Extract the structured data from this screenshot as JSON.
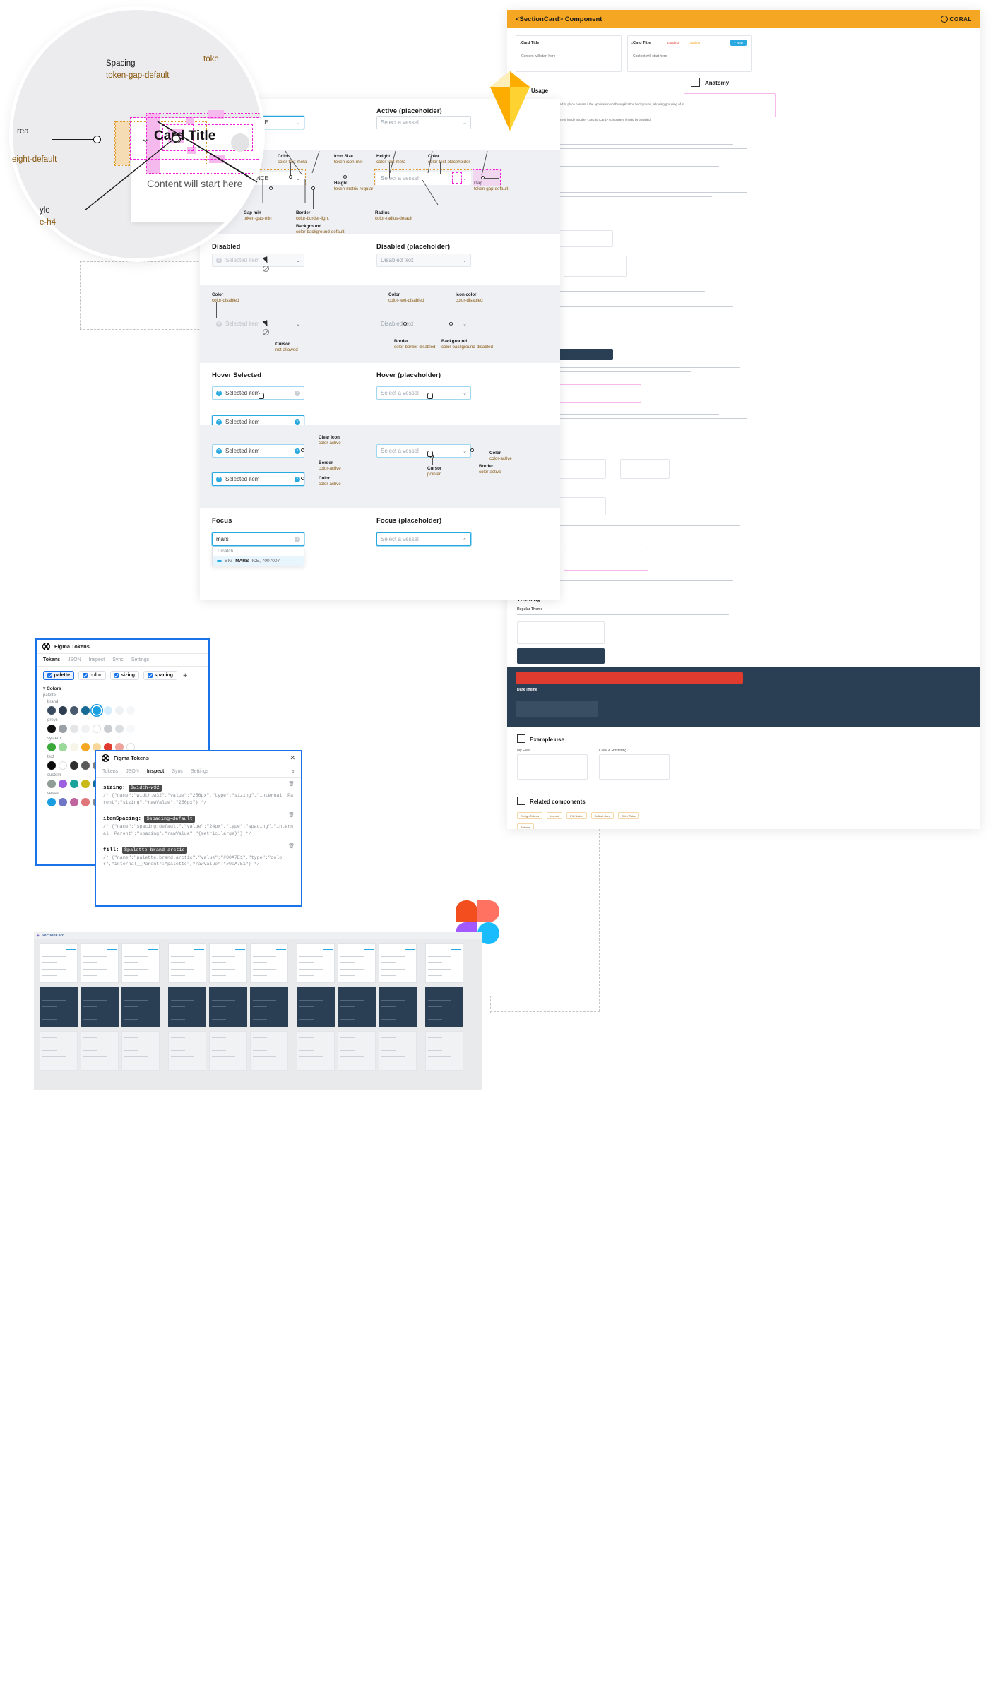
{
  "magnifier": {
    "annotations": [
      {
        "key": "Spacing",
        "value": "token-gap-default"
      },
      {
        "key": "rea",
        "value": "eight-default"
      },
      {
        "key": "yle",
        "value": "e-h4"
      },
      {
        "key": "toke",
        "value": ""
      }
    ],
    "card_title": "Card Title",
    "card_content": "Content will start here",
    "chevron_icon": "chevron-down-icon"
  },
  "spec": {
    "sections": [
      {
        "id": "active",
        "left_title": "",
        "right_title": "Active (placeholder)",
        "left_value": "RMRS, FRANCE",
        "right_placeholder": "Select a vessel"
      },
      {
        "id": "active-anno",
        "left_title": "",
        "right_title": "",
        "left_value": "RMRS, FRANCE",
        "right_placeholder": "Select a vessel"
      },
      {
        "id": "disabled",
        "left_title": "Disabled",
        "right_title": "Disabled (placeholder)",
        "left_value": "Selected item",
        "right_placeholder": "Disabled text"
      },
      {
        "id": "disabled-anno",
        "left_title": "",
        "right_title": "",
        "left_value": "Selected item",
        "right_placeholder": "Disabled text"
      },
      {
        "id": "hover",
        "left_title": "Hover Selected",
        "right_title": "Hover (placeholder)",
        "left_value": "Selected item",
        "right_placeholder": "Select a vessel",
        "left_value2": "Selected item"
      },
      {
        "id": "hover-anno",
        "left_title": "",
        "right_title": "",
        "left_value": "Selected item",
        "right_placeholder": "Select a vessel",
        "left_value2": "Selected item"
      },
      {
        "id": "focus",
        "left_title": "Focus",
        "right_title": "Focus (placeholder)",
        "left_value": "mars",
        "right_placeholder": "Select a vessel"
      }
    ],
    "annotations": {
      "active": [
        {
          "key": "Color",
          "value": "color-text-meta"
        },
        {
          "key": "Icon Size",
          "value": "token-icon-min"
        },
        {
          "key": "Height",
          "value": "color-text-meta"
        },
        {
          "key": "Color",
          "value": "color-text-placeholder"
        },
        {
          "key": "Height",
          "value": "token-metric-regular"
        },
        {
          "key": "Gap",
          "value": "token-gap-default"
        },
        {
          "key": "Gap min",
          "value": "token-gap-min"
        },
        {
          "key": "Border",
          "value": "color-border-light"
        },
        {
          "key": "Background",
          "value": "color-background-default"
        },
        {
          "key": "Radius",
          "value": "color-radius-default"
        },
        {
          "key": "",
          "value": "efault"
        }
      ],
      "disabled": [
        {
          "key": "Color",
          "value": "color-disabled"
        },
        {
          "key": "Color",
          "value": "color-text-disabled"
        },
        {
          "key": "Icon color",
          "value": "color-disabled"
        },
        {
          "key": "Cursor",
          "value": "not-allowed"
        },
        {
          "key": "Border",
          "value": "color-border-disabled"
        },
        {
          "key": "Background",
          "value": "color-background-disabled"
        }
      ],
      "hover": [
        {
          "key": "Clear icon",
          "value": "color-active"
        },
        {
          "key": "Border",
          "value": "color-active"
        },
        {
          "key": "Color",
          "value": "color-active"
        },
        {
          "key": "Cursor",
          "value": "pointer"
        },
        {
          "key": "Border",
          "value": "color-active"
        },
        {
          "key": "Color",
          "value": "color-active"
        }
      ]
    },
    "focus_dropdown": {
      "match_count": "1 match",
      "item_prefix": "BIG ",
      "item_bold": "MARS",
      "item_rest": "ICE, 7007007",
      "vessel_icon": "vessel-icon"
    }
  },
  "doc": {
    "title": "<SectionCard> Component",
    "brand": "CORAL",
    "cards": [
      {
        "title": "Card Title",
        "body": "Content will start here"
      },
      {
        "title": "Card Title",
        "body": "Content will start here",
        "tags": [
          "Loading",
          "Loading"
        ],
        "button": "+ New"
      }
    ],
    "sections": [
      {
        "icon": "target-icon",
        "title": "Usage"
      },
      {
        "icon": "anatomy-icon",
        "title": "Anatomy"
      },
      {
        "icon": "play-icon",
        "title": "Example use"
      },
      {
        "icon": "grid-icon",
        "title": "Related components"
      }
    ],
    "usage_text_1": "<SectionCard> component is used to place content if the application on the application background, allowing grouping of information in contextual tables, forms, data displays etc.",
    "usage_text_2": "Placing a <SectionCard> component inside another <SectionCard> component should be avoided.",
    "example_labels": [
      "My Fleet",
      "Crew & Rostering"
    ],
    "related_chips": [
      "Design Tokens",
      "Layout",
      "Pill / Label",
      "Callout Card",
      "Grid / Table",
      "Buttons"
    ]
  },
  "plugin_tokens": {
    "name": "Figma Tokens",
    "logo_icon": "figma-tokens-icon",
    "tabs": [
      "Tokens",
      "JSON",
      "Inspect",
      "Sync",
      "Settings"
    ],
    "active_tab": "Tokens",
    "sets": [
      {
        "label": "palette",
        "checked": true,
        "selected": true
      },
      {
        "label": "color",
        "checked": true,
        "selected": false
      },
      {
        "label": "sizing",
        "checked": true,
        "selected": false
      },
      {
        "label": "spacing",
        "checked": true,
        "selected": false
      }
    ],
    "add_icon": "plus-icon",
    "group_label": "Colors",
    "group_caret": "caret-down-icon",
    "palette_label": "palette",
    "rows": [
      {
        "name": "brand",
        "colors": [
          "#3a4a5e",
          "#2e3d50",
          "#4a5a6e",
          "#176a94",
          "#18a0e0",
          "#d6eefb",
          "#eef1f3",
          "#f4f6f7"
        ],
        "selected_index": 4
      },
      {
        "name": "greys",
        "colors": [
          "#111111",
          "#9aa0a6",
          "#e3e5e7",
          "#f0f1f2",
          "#ffffff",
          "#c9ccd0",
          "#dcdfe2",
          "#f7f8f9"
        ]
      },
      {
        "name": "system",
        "colors": [
          "#3aa93a",
          "#9ad99a",
          "#f7f4e8",
          "#f5a623",
          "#f8d79a",
          "#e03b2f",
          "#f0a39c",
          "#ffffff"
        ]
      },
      {
        "name": "text",
        "colors": [
          "#0a0a0a",
          "#ffffff",
          "#2f2f2f",
          "#5a5a5a",
          "#808080",
          "#a8a8a8",
          "#cccccc",
          "#e8e8e8"
        ]
      },
      {
        "name": "custom",
        "colors": [
          "#8f9d96",
          "#9b5fe0",
          "#1aa39b",
          "#c9b816",
          "#176a94",
          "#2b3f54",
          "#7d8c9a",
          "#b0bac3"
        ]
      },
      {
        "name": "vessel",
        "colors": [
          "#1a9ce0",
          "#6f76c6",
          "#c0649e",
          "#e0757a",
          "#7d8c9a",
          "#4a8fc4",
          "#9b9b9b",
          "#cfcfcf"
        ]
      }
    ]
  },
  "plugin_inspect": {
    "name": "Figma Tokens",
    "logo_icon": "figma-tokens-icon",
    "close_icon": "close-icon",
    "search_icon": "search-icon",
    "tabs": [
      "Tokens",
      "JSON",
      "Inspect",
      "Sync",
      "Settings"
    ],
    "active_tab": "Inspect",
    "entries": [
      {
        "key": "sizing:",
        "tag": "$width-w32",
        "comment": "/* {\"name\":\"width.w32\",\"value\":\"256px\",\"type\":\"sizing\",\"internal__Parent\":\"sizing\",\"rawValue\":\"256px\"} */",
        "delete_icon": "trash-icon"
      },
      {
        "key": "itemSpacing:",
        "tag": "$spacing-default",
        "comment": "/* {\"name\":\"spacing.default\",\"value\":\"24px\",\"type\":\"spacing\",\"internal__Parent\":\"spacing\",\"rawValue\":\"{metric.large}\"} */",
        "delete_icon": "trash-icon"
      },
      {
        "key": "fill:",
        "tag": "$palette-brand-arctic",
        "comment": "/* {\"name\":\"palette.brand.arctic\",\"value\":\"#00A7E1\",\"type\":\"color\",\"internal__Parent\":\"palette\",\"rawValue\":\"#00A7E1\"} */",
        "delete_icon": "trash-icon"
      }
    ]
  },
  "board": {
    "label": "SectionCard",
    "icon": "component-icon"
  },
  "colors": {
    "accent_blue": "#1a9ce0",
    "brand_orange": "#f5a623",
    "token_brown": "#8a5a12",
    "magenta": "#f221d8",
    "dark_navy": "#2b3f54",
    "panel_grey": "#eef0f4"
  }
}
